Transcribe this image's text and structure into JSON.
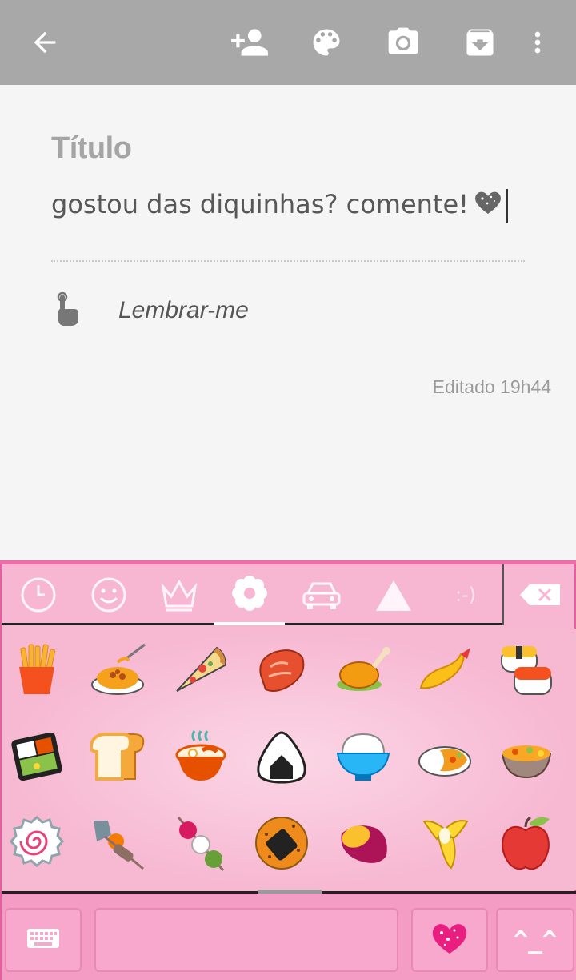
{
  "toolbar": {
    "icons": [
      "back-arrow-icon",
      "add-collaborator-icon",
      "palette-icon",
      "camera-icon",
      "archive-icon",
      "more-vert-icon"
    ]
  },
  "note": {
    "title_placeholder": "Título",
    "body": "gostou das diquinhas? comente!",
    "reminder_label": "Lembrar-me",
    "edited": "Editado 19h44"
  },
  "keyboard": {
    "categories": [
      "recent",
      "smileys",
      "crown",
      "flower",
      "car",
      "triangle",
      "emoticons"
    ],
    "active_category": "flower",
    "emoticon_tab_label": ":-)",
    "kaomoji_label": "^_^",
    "emojis": [
      "french-fries",
      "spaghetti",
      "pizza",
      "meat",
      "poultry-leg",
      "fried-shrimp",
      "sushi",
      "bento-box",
      "bread",
      "ramen",
      "rice-ball",
      "cooked-rice",
      "curry-rice",
      "stew",
      "fish-cake",
      "oden",
      "dango",
      "rice-cracker",
      "roasted-sweet-potato",
      "banana",
      "red-apple"
    ],
    "colors": {
      "accent": "#f06ba8",
      "background": "#f7b7d3"
    }
  }
}
